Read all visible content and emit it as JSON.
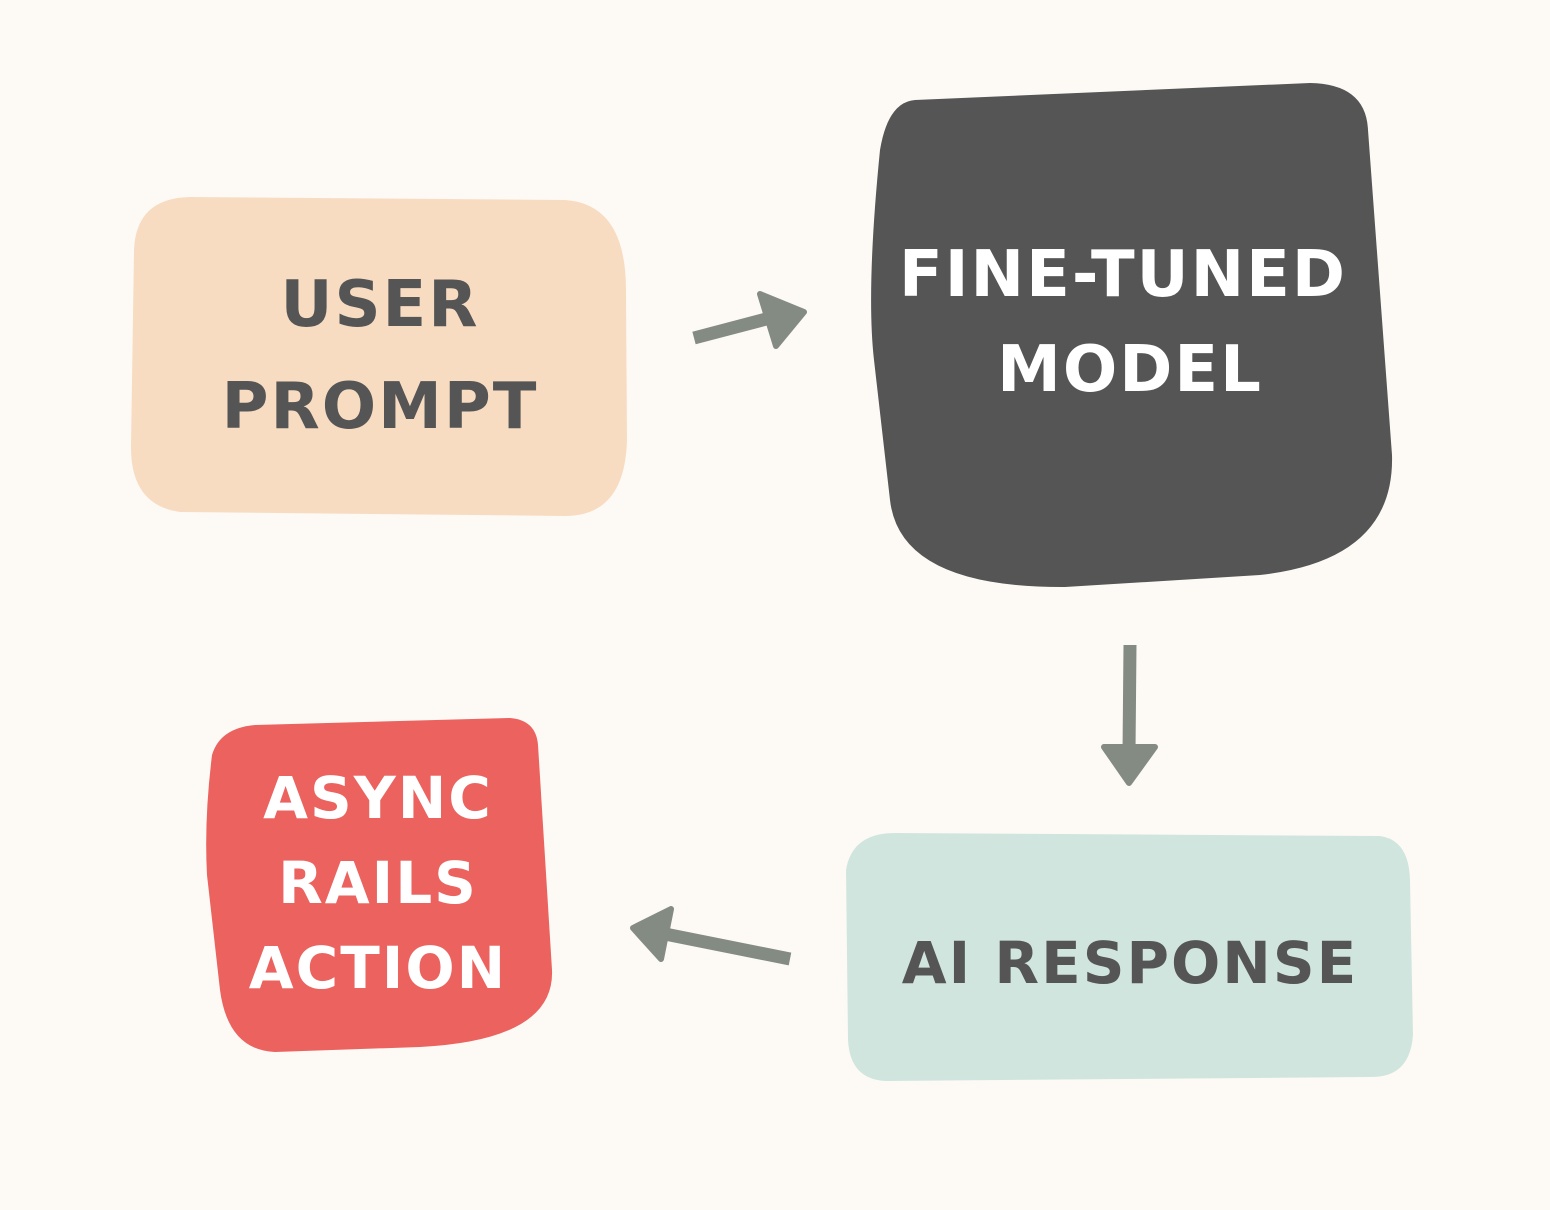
{
  "colors": {
    "background": "#fdfaf6",
    "user_prompt_fill": "#f8dcc2",
    "model_fill": "#555555",
    "response_fill": "#d1e5df",
    "action_fill": "#eb625e",
    "arrow": "#838b82",
    "dark_text": "#555555",
    "light_text": "#ffffff"
  },
  "nodes": {
    "user_prompt": {
      "line1": "USER",
      "line2": "PROMPT"
    },
    "model": {
      "line1": "FINE-TUNED",
      "line2": "MODEL"
    },
    "response": {
      "line1": "AI RESPONSE"
    },
    "action": {
      "line1": "ASYNC",
      "line2": "RAILS",
      "line3": "ACTION"
    }
  },
  "edges": [
    {
      "from": "user_prompt",
      "to": "model"
    },
    {
      "from": "model",
      "to": "response"
    },
    {
      "from": "response",
      "to": "action"
    }
  ]
}
